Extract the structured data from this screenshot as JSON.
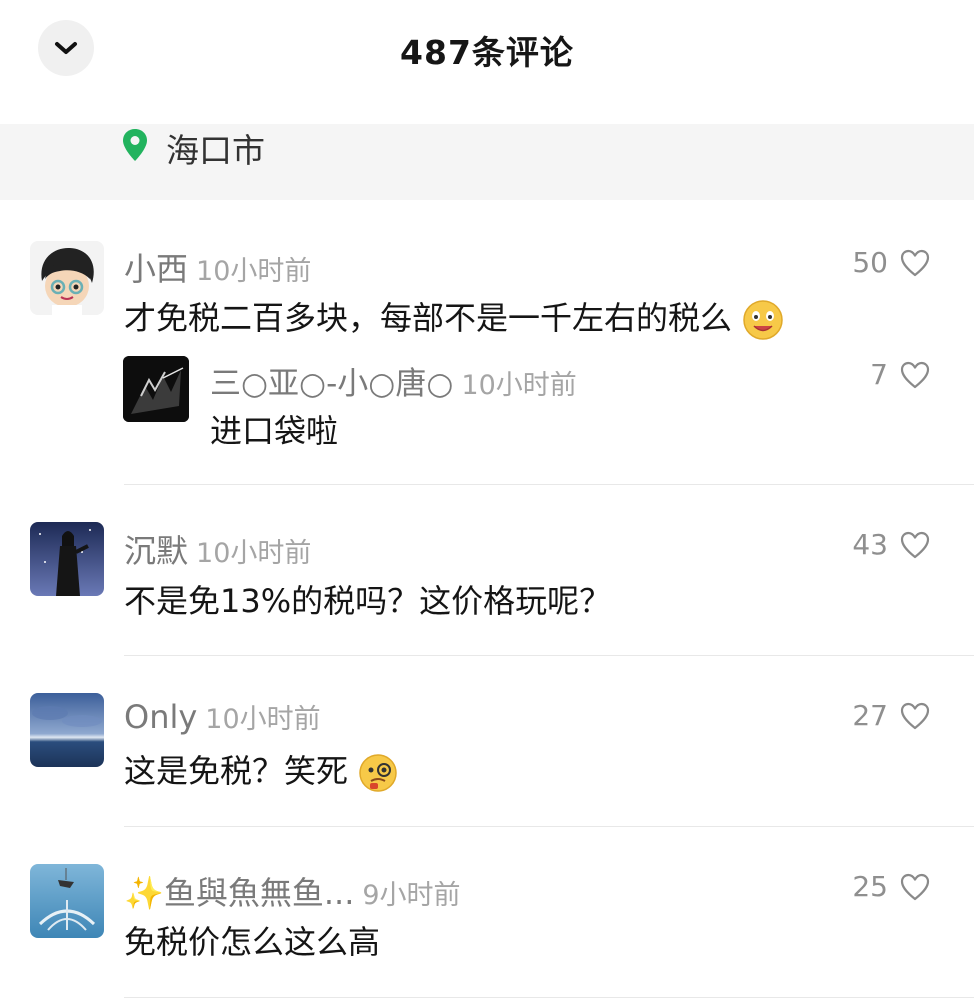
{
  "header": {
    "title": "487条评论",
    "back_icon": "chevron-down-icon"
  },
  "location": {
    "icon": "location-pin-icon",
    "text": "海口市",
    "icon_color": "#22b35e"
  },
  "comments": [
    {
      "username": "小西",
      "time": "10小时前",
      "text": "才免税二百多块，每部不是一千左右的税么",
      "emoji": "money-mouth-face",
      "likes": "50",
      "reply": {
        "username": "三○亚○-小○唐○",
        "time": "10小时前",
        "text": "进口袋啦",
        "likes": "7"
      }
    },
    {
      "username": "沉默",
      "time": "10小时前",
      "text": "不是免13%的税吗？这价格玩呢？",
      "likes": "43"
    },
    {
      "username": "Only",
      "time": "10小时前",
      "text": "这是免税？笑死",
      "emoji": "face-with-monocle",
      "likes": "27"
    },
    {
      "username": "✨鱼與魚無鱼...",
      "time": "9小时前",
      "text": "免税价怎么这么高",
      "likes": "25"
    }
  ]
}
